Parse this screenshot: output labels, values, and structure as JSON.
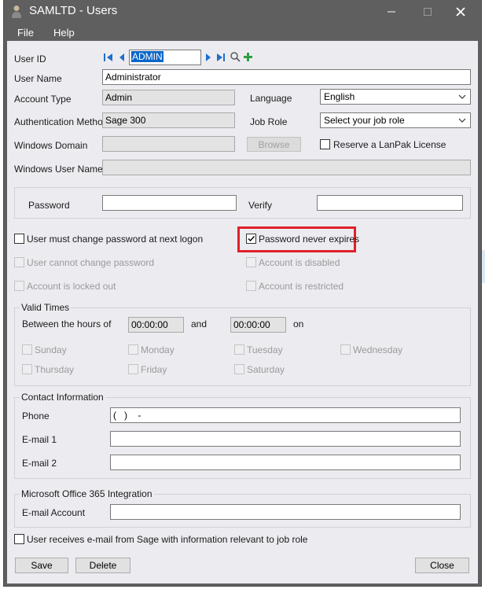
{
  "window": {
    "title": "SAMLTD - Users",
    "menu": [
      "File",
      "Help"
    ],
    "controls": {
      "minimize": "—",
      "maximize": "☐",
      "close": "✕"
    }
  },
  "form": {
    "user_id": {
      "label": "User ID",
      "value": "ADMIN"
    },
    "user_name": {
      "label": "User Name",
      "value": "Administrator"
    },
    "account_type": {
      "label": "Account Type",
      "value": "Admin"
    },
    "language": {
      "label": "Language",
      "value": "English"
    },
    "auth_method": {
      "label": "Authentication Method",
      "value": "Sage 300"
    },
    "job_role": {
      "label": "Job Role",
      "value": "Select your job role"
    },
    "windows_domain": {
      "label": "Windows Domain",
      "value": ""
    },
    "browse_button": "Browse",
    "lanpak": {
      "label": "Reserve a LanPak License",
      "checked": false
    },
    "windows_user_name": {
      "label": "Windows User Name",
      "value": ""
    },
    "password": {
      "label": "Password",
      "value": ""
    },
    "verify": {
      "label": "Verify",
      "value": ""
    },
    "options": {
      "must_change": {
        "label": "User must change password at next logon",
        "checked": false,
        "enabled": true
      },
      "never_expires": {
        "label": "Password never expires",
        "checked": true,
        "enabled": true
      },
      "cannot_change": {
        "label": "User cannot change password",
        "checked": false,
        "enabled": false
      },
      "disabled": {
        "label": "Account is disabled",
        "checked": false,
        "enabled": false
      },
      "locked_out": {
        "label": "Account is locked out",
        "checked": false,
        "enabled": false
      },
      "restricted": {
        "label": "Account is restricted",
        "checked": false,
        "enabled": false
      }
    },
    "valid_times": {
      "title": "Valid Times",
      "between_label": "Between the hours of",
      "from": "00:00:00",
      "and_label": "and",
      "to": "00:00:00",
      "on_label": "on",
      "days": [
        "Sunday",
        "Monday",
        "Tuesday",
        "Wednesday",
        "Thursday",
        "Friday",
        "Saturday"
      ]
    },
    "contact": {
      "title": "Contact Information",
      "phone_label": "Phone",
      "phone_value": "(   )    -",
      "email1_label": "E-mail 1",
      "email1_value": "",
      "email2_label": "E-mail 2",
      "email2_value": ""
    },
    "office365": {
      "title": "Microsoft Office 365 Integration",
      "email_label": "E-mail Account",
      "email_value": ""
    },
    "receive_email": {
      "label": "User receives e-mail from Sage with information relevant to job role",
      "checked": false
    }
  },
  "buttons": {
    "save": "Save",
    "delete": "Delete",
    "close": "Close"
  },
  "colors": {
    "highlight": "#e0202a",
    "nav_icons": "#1e6fc9",
    "add_icon": "#2ea043",
    "selection": "#0a66c8"
  }
}
